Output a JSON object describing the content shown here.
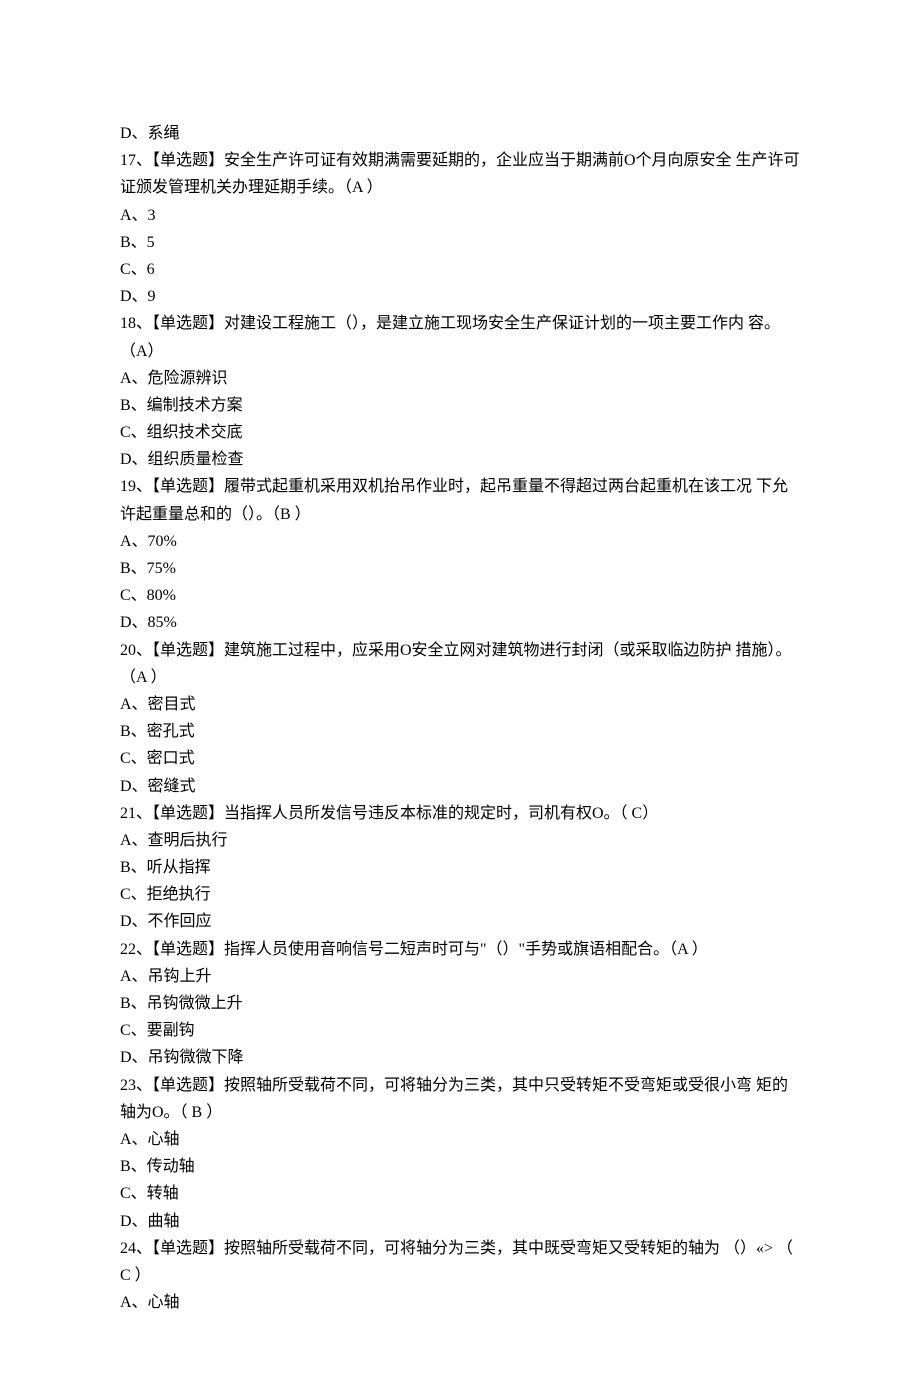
{
  "lines": [
    "D、系绳",
    "17、【单选题】安全生产许可证有效期满需要延期的，企业应当于期满前O个月向原安全 生产许可证颁发管理机关办理延期手续。（A ）",
    "A、3",
    "B、5",
    "C、6",
    "D、9",
    "18、【单选题】对建设工程施工（），是建立施工现场安全生产保证计划的一项主要工作内 容。（A）",
    "A、危险源辨识",
    "B、编制技术方案",
    "C、组织技术交底",
    "D、组织质量检查",
    "19、【单选题】履带式起重机采用双机抬吊作业时，起吊重量不得超过两台起重机在该工况 下允许起重量总和的（）。（B ）",
    "A、70%",
    "B、75%",
    "C、80%",
    "D、85%",
    "20、【单选题】建筑施工过程中，应采用O安全立网对建筑物进行封闭（或采取临边防护 措施）。（A ）",
    "A、密目式",
    "B、密孔式",
    "C、密口式",
    "D、密缝式",
    "21、【单选题】当指挥人员所发信号违反本标准的规定时，司机有权O。（ C）",
    "A、查明后执行",
    "B、听从指挥",
    "C、拒绝执行",
    "D、不作回应",
    "22、【单选题】指挥人员使用音响信号二短声时可与\"（）\"手势或旗语相配合。（A ）",
    "A、吊钩上升",
    "B、吊钩微微上升",
    "C、要副钩",
    "D、吊钩微微下降",
    "23、【单选题】按照轴所受载荷不同，可将轴分为三类，其中只受转矩不受弯矩或受很小弯 矩的轴为O。（ B ）",
    "A、心轴",
    "B、传动轴",
    "C、转轴",
    "D、曲轴",
    "24、【单选题】按照轴所受载荷不同，可将轴分为三类，其中既受弯矩又受转矩的轴为 （）«> （ C ）",
    "A、心轴"
  ]
}
